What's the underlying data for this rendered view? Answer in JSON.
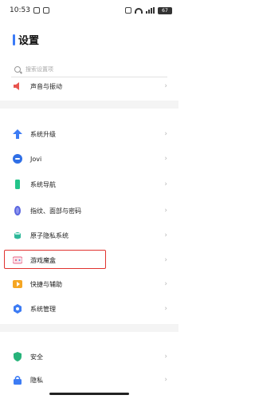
{
  "status_bar": {
    "time": "10:53",
    "battery": "67"
  },
  "page": {
    "title": "设置",
    "search_placeholder": "搜索设置项"
  },
  "items": [
    {
      "label": "声音与振动",
      "icon": "speaker-icon",
      "color": "#e8554f"
    },
    {
      "label": "系统升级",
      "icon": "upgrade-arrow-icon",
      "color": "#3d7cf4"
    },
    {
      "label": "Jovi",
      "icon": "jovi-icon",
      "color": "#2f6fe6"
    },
    {
      "label": "系统导航",
      "icon": "navigation-phone-icon",
      "color": "#23c48a"
    },
    {
      "label": "指纹、面部与密码",
      "icon": "fingerprint-icon",
      "color": "#5a66e0"
    },
    {
      "label": "原子隐私系统",
      "icon": "atom-privacy-icon",
      "color": "#2fb89a"
    },
    {
      "label": "游戏魔盒",
      "icon": "game-box-icon",
      "color": "#e86a8a"
    },
    {
      "label": "快捷与辅助",
      "icon": "shortcut-icon",
      "color": "#f5a623"
    },
    {
      "label": "系统管理",
      "icon": "system-management-icon",
      "color": "#3d7cf4"
    },
    {
      "label": "安全",
      "icon": "shield-icon",
      "color": "#27b37a"
    },
    {
      "label": "隐私",
      "icon": "privacy-icon",
      "color": "#3d7cf4"
    }
  ],
  "chevron": "›"
}
